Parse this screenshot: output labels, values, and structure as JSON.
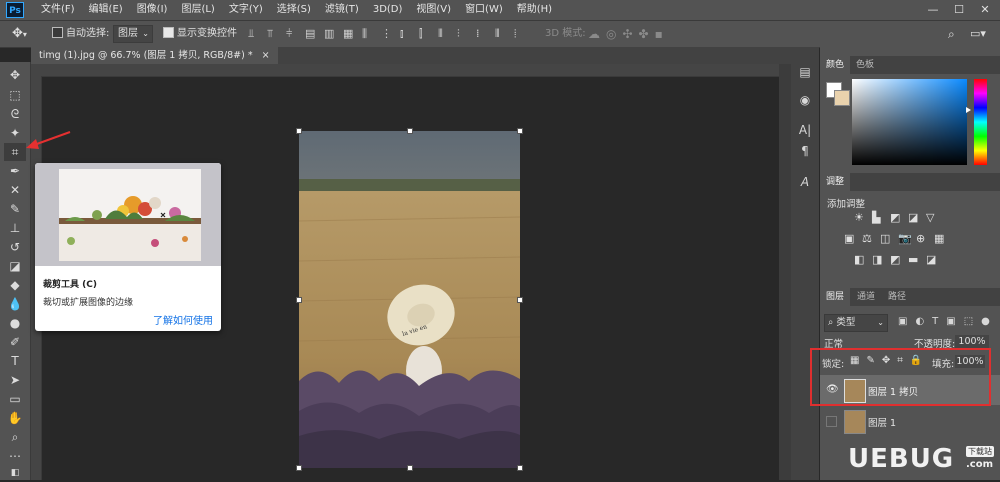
{
  "app": {
    "logo": "Ps"
  },
  "menu": [
    "文件(F)",
    "编辑(E)",
    "图像(I)",
    "图层(L)",
    "文字(Y)",
    "选择(S)",
    "滤镜(T)",
    "3D(D)",
    "视图(V)",
    "窗口(W)",
    "帮助(H)"
  ],
  "window_controls": {
    "minimize": "—",
    "maximize": "☐",
    "close": "✕"
  },
  "options": {
    "auto_select_label": "自动选择:",
    "auto_select_value": "图层",
    "show_transform_label": "显示变换控件",
    "mode3d_label": "3D 模式:"
  },
  "document": {
    "tab_title": "timg (1).jpg @ 66.7% (图层 1 拷贝, RGB/8#) *",
    "close": "×"
  },
  "tooltip": {
    "title": "裁剪工具 (C)",
    "description": "裁切或扩展图像的边缘",
    "link": "了解如何使用"
  },
  "color_panel": {
    "tabs": [
      "颜色",
      "色板"
    ]
  },
  "adjust_panel": {
    "tab": "调整",
    "add_label": "添加调整"
  },
  "layers_panel": {
    "tabs": [
      "图层",
      "通道",
      "路径"
    ],
    "filter_kind": "类型",
    "blend_mode": "正常",
    "opacity_label": "不透明度:",
    "opacity_value": "100%",
    "lock_label": "锁定:",
    "fill_label": "填充:",
    "fill_value": "100%",
    "layers": [
      {
        "name": "图层 1 拷贝",
        "selected": true,
        "visible": true
      },
      {
        "name": "图层 1",
        "selected": false,
        "visible": false
      }
    ]
  },
  "watermark": {
    "brand": "UEBUG",
    "sub": "下载站",
    "domain": ".com"
  },
  "colors": {
    "accent": "#31a8ff",
    "highlight_box": "#e02f2f",
    "link": "#1473e6"
  }
}
